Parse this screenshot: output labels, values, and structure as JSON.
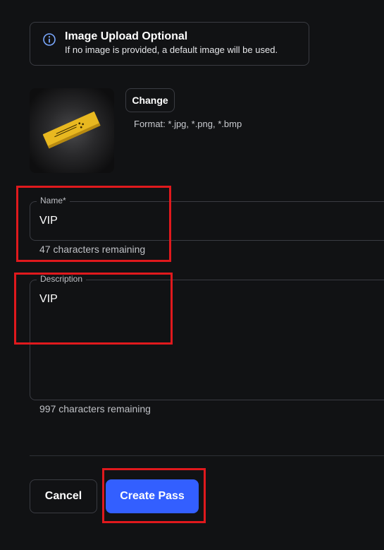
{
  "banner": {
    "icon": "info-circle-icon",
    "title": "Image Upload Optional",
    "message": "If no image is provided, a default image will be used."
  },
  "image": {
    "thumbnail_icon": "ticket-pass-icon",
    "change_label": "Change",
    "format_hint": "Format: *.jpg, *.png, *.bmp"
  },
  "name_field": {
    "label": "Name",
    "required_marker": "*",
    "value": "VIP",
    "helper": "47 characters remaining"
  },
  "description_field": {
    "label": "Description",
    "value": "VIP",
    "helper": "997 characters remaining"
  },
  "actions": {
    "cancel_label": "Cancel",
    "create_label": "Create Pass"
  },
  "colors": {
    "background": "#111214",
    "border": "#3a3c42",
    "primary": "#335fff",
    "info_icon": "#7aa8ff",
    "highlight": "#e0191d",
    "ticket": "#e8b820"
  }
}
